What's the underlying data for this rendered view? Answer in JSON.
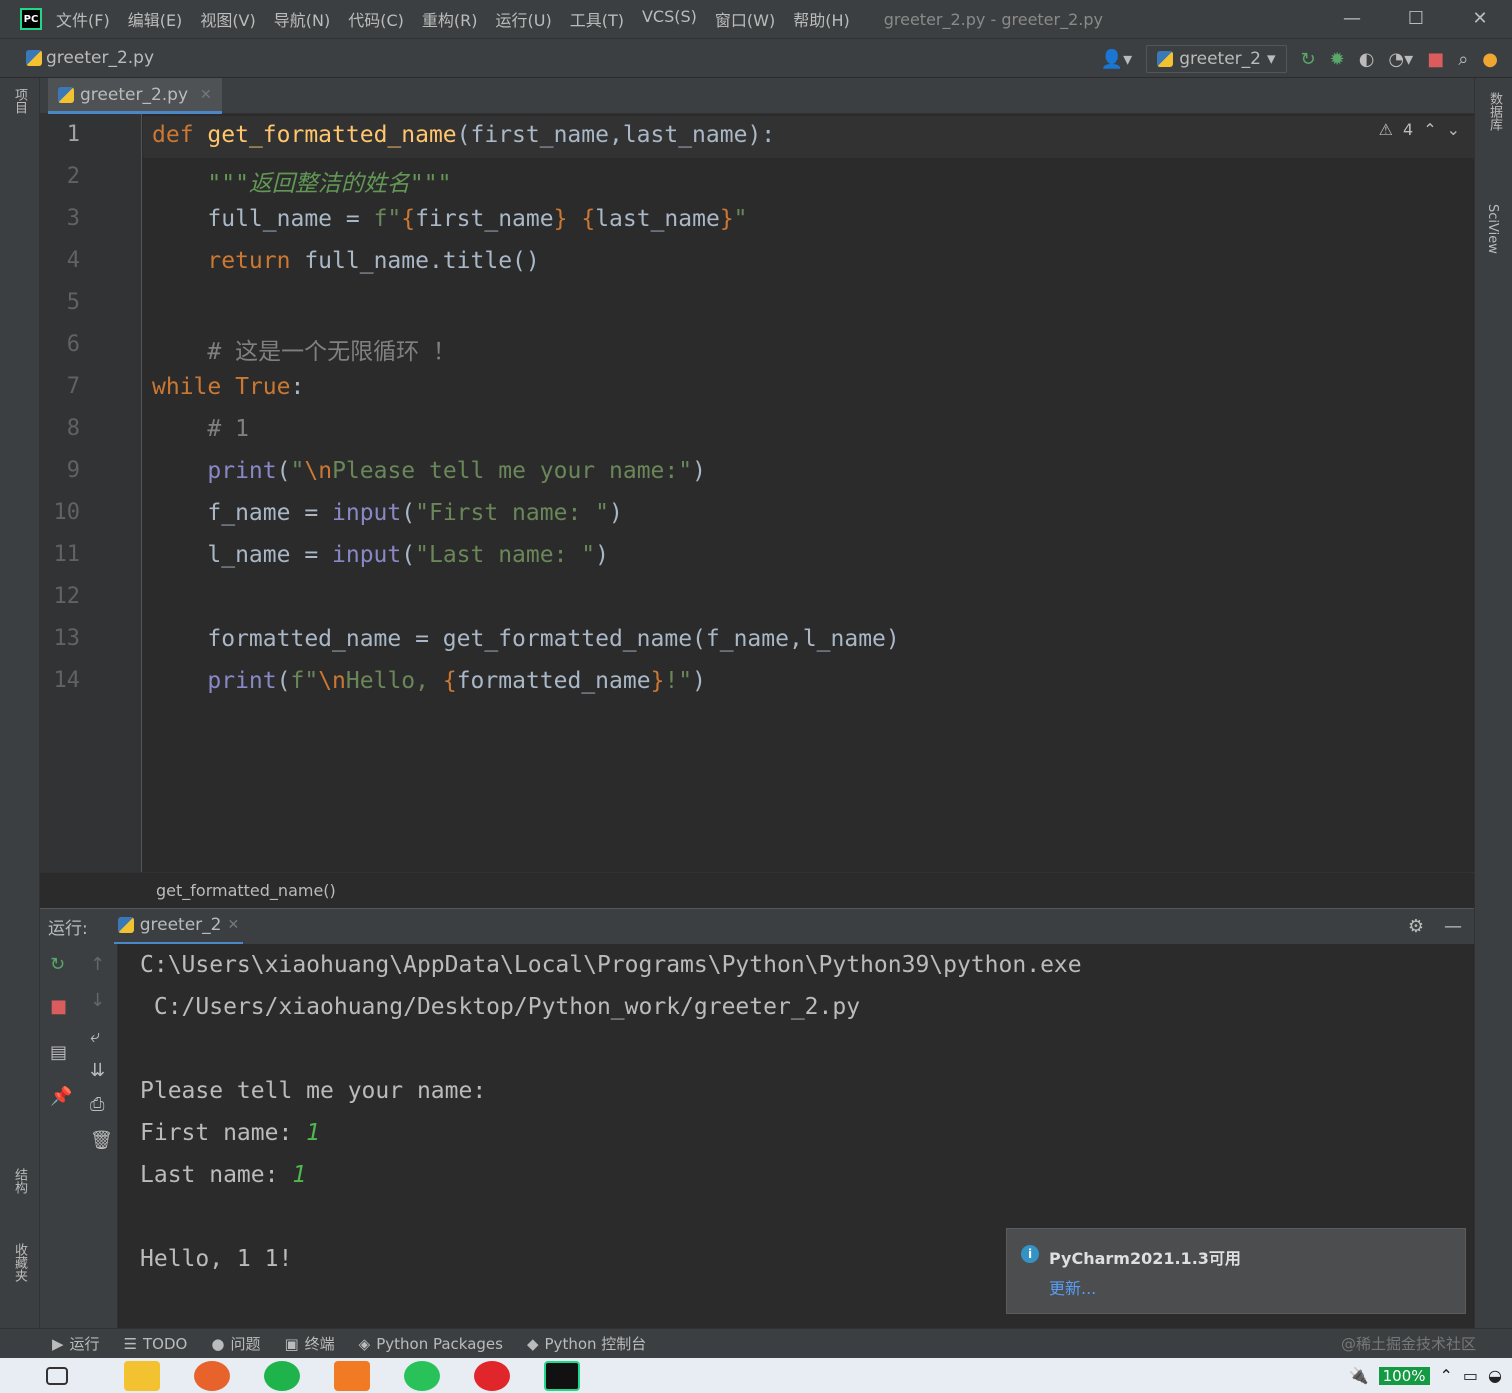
{
  "titlebar": {
    "logo": "PC",
    "menu": [
      "文件(F)",
      "编辑(E)",
      "视图(V)",
      "导航(N)",
      "代码(C)",
      "重构(R)",
      "运行(U)",
      "工具(T)",
      "VCS(S)",
      "窗口(W)",
      "帮助(H)"
    ],
    "window_title": "greeter_2.py - greeter_2.py",
    "controls": [
      "—",
      "☐",
      "✕"
    ]
  },
  "navbar": {
    "file": "greeter_2.py",
    "run_config": "greeter_2"
  },
  "left_strip": {
    "project": "项目",
    "structure": "结构",
    "favorites": "收藏夹"
  },
  "right_strip": {
    "database": "数据库",
    "sciview": "SciView"
  },
  "editor": {
    "tab": "greeter_2.py",
    "inspection_count": "4",
    "line_numbers": [
      "1",
      "2",
      "3",
      "4",
      "5",
      "6",
      "7",
      "8",
      "9",
      "10",
      "11",
      "12",
      "13",
      "14"
    ],
    "code": {
      "l1_kw": "def",
      "l1_fn": "get_formatted_name",
      "l1_rest": "(first_name,last_name):",
      "l2_doc": "\"\"\"返回整洁的姓名\"\"\"",
      "l3_a": "full_name = ",
      "l3_f": "f\"",
      "l3_b1": "{",
      "l3_v1": "first_name",
      "l3_b2": "}",
      "l3_sp": " ",
      "l3_b3": "{",
      "l3_v2": "last_name",
      "l3_b4": "}",
      "l3_q": "\"",
      "l4_kw": "return",
      "l4_rest": " full_name.title()",
      "l6_cm": "# 这是一个无限循环 ！",
      "l7_kw": "while",
      "l7_t": "True",
      "l7_c": ":",
      "l8_cm": "# 1",
      "l9_bi": "print",
      "l9_p": "(",
      "l9_s1": "\"",
      "l9_es": "\\n",
      "l9_s2": "Please tell me your name:\"",
      "l9_e": ")",
      "l10_a": "f_name = ",
      "l10_bi": "input",
      "l10_p": "(",
      "l10_s": "\"First name: \"",
      "l10_e": ")",
      "l11_a": "l_name = ",
      "l11_bi": "input",
      "l11_p": "(",
      "l11_s": "\"Last name: \"",
      "l11_e": ")",
      "l13": "formatted_name = get_formatted_name(f_name,l_name)",
      "l14_bi": "print",
      "l14_p": "(",
      "l14_f": "f\"",
      "l14_es": "\\n",
      "l14_s": "Hello, ",
      "l14_b1": "{",
      "l14_v": "formatted_name",
      "l14_b2": "}",
      "l14_s2": "!\"",
      "l14_e": ")"
    },
    "breadcrumb": "get_formatted_name()"
  },
  "run_panel": {
    "label": "运行:",
    "tab": "greeter_2",
    "console": {
      "path1": "C:\\Users\\xiaohuang\\AppData\\Local\\Programs\\Python\\Python39\\python.exe",
      "path2": " C:/Users/xiaohuang/Desktop/Python_work/greeter_2.py",
      "prompt": "Please tell me your name:",
      "first_label": "First name: ",
      "first_value": "1",
      "last_label": "Last name: ",
      "last_value": "1",
      "hello": "Hello, 1 1!"
    }
  },
  "notification": {
    "title": "PyCharm2021.1.3可用",
    "link": "更新..."
  },
  "statusbar": {
    "items": [
      "运行",
      "TODO",
      "问题",
      "终端",
      "Python Packages",
      "Python 控制台"
    ],
    "watermark": "@稀土掘金技术社区"
  },
  "taskbar": {
    "battery": "100%"
  },
  "colors": {
    "accent": "#4a88c7",
    "keyword": "#cc7832",
    "function": "#ffc66d",
    "string": "#6a8759",
    "comment": "#808080",
    "builtin": "#8888c6",
    "user_input": "#4eb84e"
  }
}
